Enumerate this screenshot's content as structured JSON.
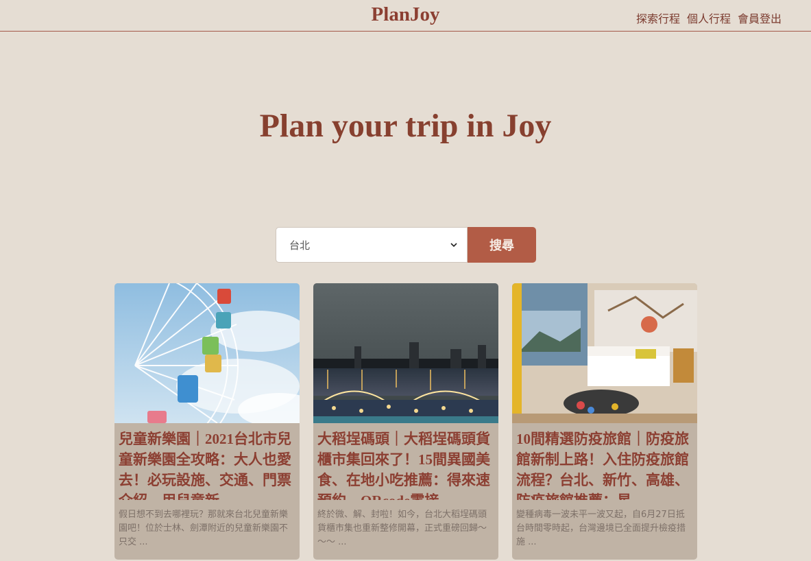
{
  "header": {
    "brand": "PlanJoy",
    "nav": [
      {
        "label": "探索行程"
      },
      {
        "label": "個人行程"
      },
      {
        "label": "會員登出"
      }
    ]
  },
  "hero": {
    "title": "Plan your trip in Joy"
  },
  "search": {
    "selected_city": "台北",
    "button_label": "搜尋"
  },
  "cards": [
    {
      "title": "兒童新樂園｜2021台北市兒童新樂園全攻略：大人也愛去！必玩設施、交通、門票介紹，用兒童新",
      "description": "假日想不到去哪裡玩？那就來台北兒童新樂園吧！位於士林、劍潭附近的兒童新樂園不只交 ...",
      "image": "ferris-wheel-photo"
    },
    {
      "title": "大稻埕碼頭｜大稻埕碼頭貨櫃市集回來了！15間異國美食、在地小吃推薦：得來速預約、QRcode零接",
      "description": "終於微、解、封啦！如今，台北大稻埕碼頭貨櫃市集也重新整修開幕，正式重磅回歸～～～ ...",
      "image": "riverside-night-market-photo"
    },
    {
      "title": "10間精選防疫旅館｜防疫旅館新制上路！入住防疫旅館流程？台北、新竹、高雄、防疫旅館推薦：星",
      "description": "變種病毒一波未平一波又起，自6月27日抵台時間零時起，台灣邊境已全面提升檢疫措施 ...",
      "image": "hotel-room-photo"
    }
  ]
}
